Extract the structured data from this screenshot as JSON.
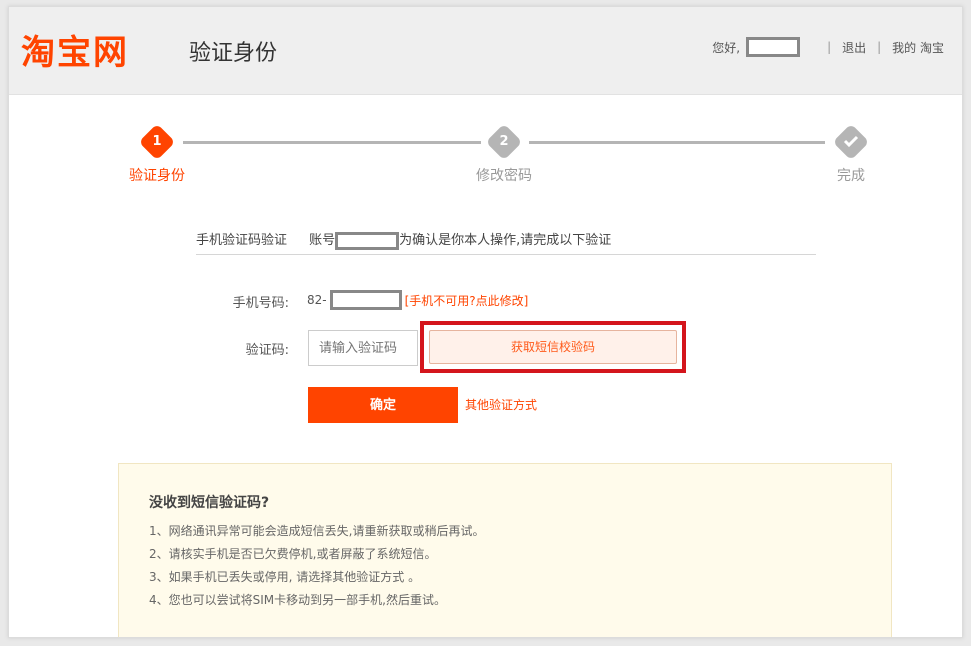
{
  "header": {
    "logo": "淘宝网",
    "title": "验证身份",
    "greeting": "您好,",
    "logout": "退出",
    "my_taobao": "我的 淘宝",
    "separator": "|"
  },
  "steps": [
    {
      "num": "1",
      "label": "验证身份",
      "state": "active"
    },
    {
      "num": "2",
      "label": "修改密码",
      "state": "inactive"
    },
    {
      "num": "",
      "label": "完成",
      "state": "done"
    }
  ],
  "colors": {
    "accent": "#ff4400",
    "highlight_box": "#d4151c",
    "inactive": "#b5b5b5"
  },
  "verify": {
    "method": "手机验证码验证",
    "account_prefix": "账号",
    "instruction": "为确认是你本人操作,请完成以下验证"
  },
  "form": {
    "phone_label": "手机号码:",
    "phone_prefix": "82-",
    "phone_unavailable": "[手机不可用?点此修改]",
    "code_label": "验证码:",
    "code_placeholder": "请输入验证码",
    "get_sms_button": "获取短信校验码",
    "confirm_button": "确定",
    "other_methods": "其他验证方式"
  },
  "help": {
    "title": "没收到短信验证码?",
    "items": [
      "1、网络通讯异常可能会造成短信丢失,请重新获取或稍后再试。",
      "2、请核实手机是否已欠费停机,或者屏蔽了系统短信。",
      "3、如果手机已丢失或停用, 请选择其他验证方式 。",
      "4、您也可以尝试将SIM卡移动到另一部手机,然后重试。"
    ]
  }
}
